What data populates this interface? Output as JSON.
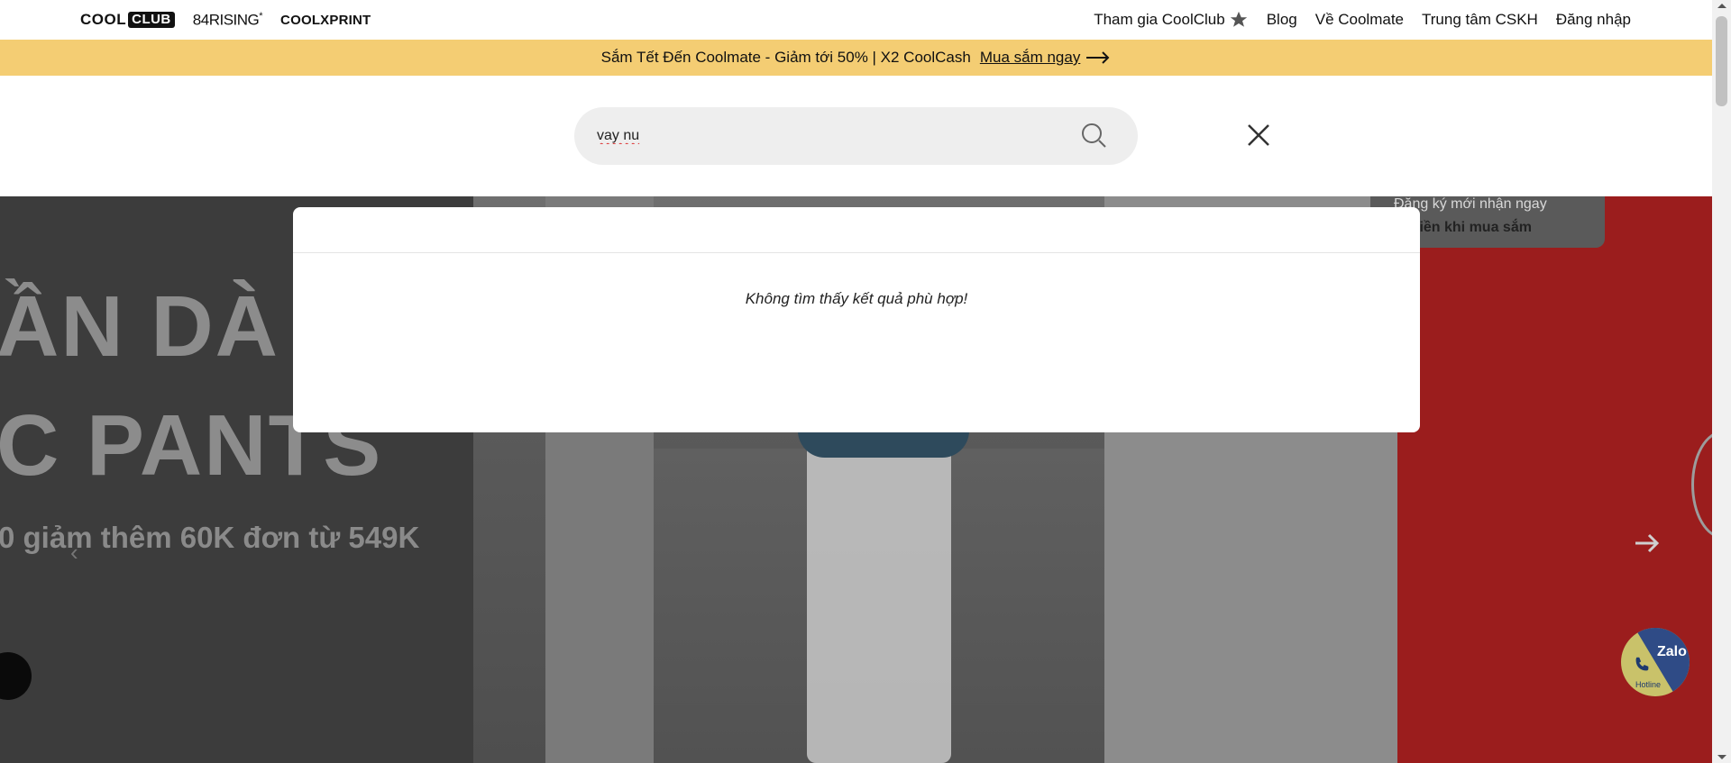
{
  "brands": {
    "coolclub_a": "COOL",
    "coolclub_b": "CLUB",
    "rising": "84RISING",
    "rising_mark": "*",
    "xprint": "COOLXPRINT"
  },
  "topnav": {
    "join": "Tham gia CoolClub",
    "blog": "Blog",
    "about": "Về Coolmate",
    "support": "Trung tâm CSKH",
    "login": "Đăng nhập"
  },
  "promo": {
    "text": "Sắm Tết Đến Coolmate - Giảm tới 50% | X2 CoolCash",
    "cta": "Mua sắm ngay"
  },
  "search": {
    "value": "vay nu",
    "icon": "search-icon",
    "close_icon": "close-icon"
  },
  "hero": {
    "line1": "ẦN DÀ",
    "line2": "C PANTS",
    "line3": "0 giảm thêm 60K đơn từ 549K",
    "card_line1": "Đăng ký mới nhận ngay",
    "card_line2": "an tiền khi mua sắm"
  },
  "results": {
    "empty_message": "Không tìm thấy kết quả phù hợp!"
  },
  "contact": {
    "zalo": "Zalo",
    "hotline": "Hotline"
  },
  "colors": {
    "promo_bg": "#f4cd73",
    "search_bg": "#eeeeee",
    "hero_red": "#9b1d1d"
  }
}
